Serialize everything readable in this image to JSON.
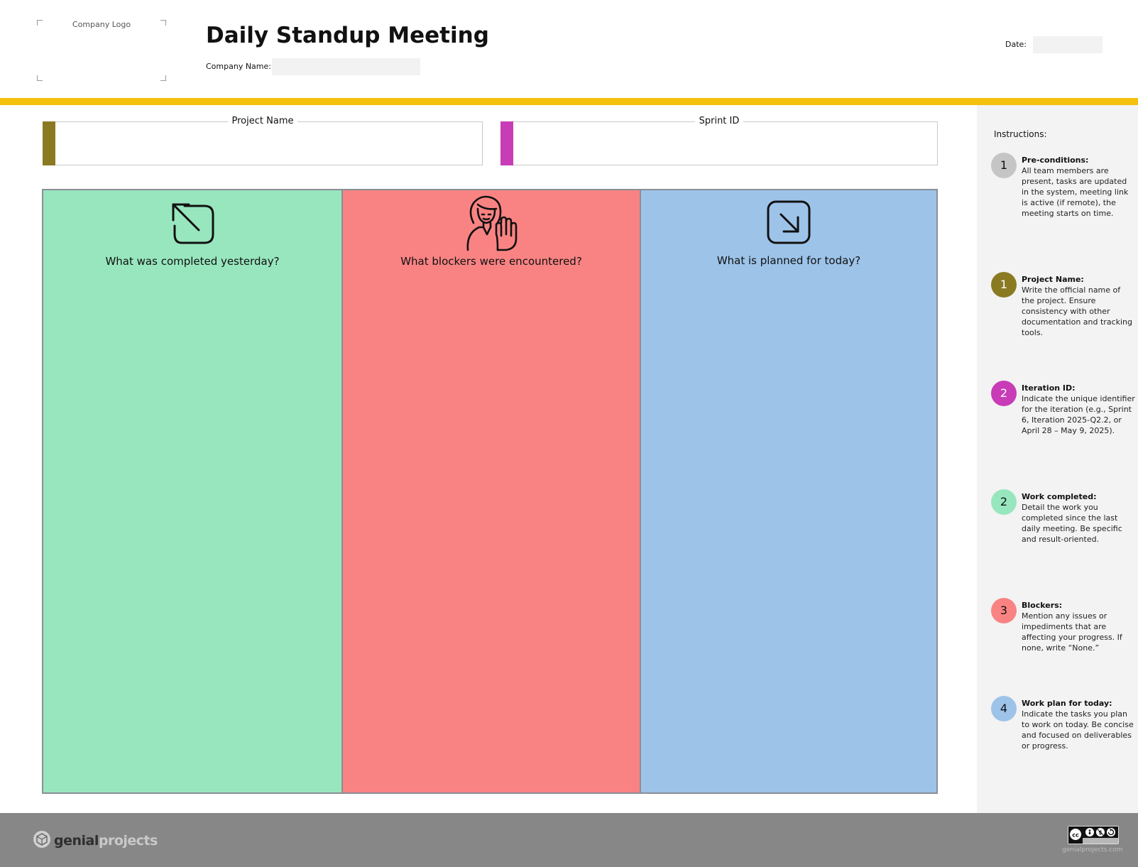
{
  "header": {
    "logo_placeholder": "Company Logo",
    "title": "Daily Standup Meeting",
    "company_label": "Company Name:",
    "date_label": "Date:"
  },
  "fields": {
    "project_name": "Project Name",
    "sprint_id": "Sprint ID"
  },
  "board": {
    "columns": [
      {
        "title": "What was completed yesterday?",
        "icon": "arrow-up-left-icon",
        "color": "#98e6be"
      },
      {
        "title": "What blockers were encountered?",
        "icon": "person-stop-hand-icon",
        "color": "#f98383"
      },
      {
        "title": "What is planned for today?",
        "icon": "arrow-down-right-icon",
        "color": "#9dc3e9"
      }
    ]
  },
  "instructions": {
    "title": "Instructions:",
    "steps": [
      {
        "number": "1",
        "color": "#c5c5c5",
        "heading": "Pre-conditions:",
        "text": "All team members are present, tasks are updated in the system, meeting link is active (if remote), the meeting starts on time."
      },
      {
        "number": "1",
        "color": "#8a7a22",
        "heading": "Project Name:",
        "text": "Write the official name of the project. Ensure consistency with other documentation and tracking tools."
      },
      {
        "number": "2",
        "color": "#c83cb7",
        "heading": "Iteration ID:",
        "text": "Indicate the unique identifier for the iteration (e.g., Sprint 6, Iteration 2025-Q2.2, or April 28 – May 9, 2025)."
      },
      {
        "number": "2",
        "color": "#98e6be",
        "heading": "Work completed:",
        "text": "Detail the work you completed since the last daily meeting. Be specific and result-oriented."
      },
      {
        "number": "3",
        "color": "#f98383",
        "heading": "Blockers:",
        "text": "Mention any issues or impediments that are affecting your progress. If none, write “None.”"
      },
      {
        "number": "4",
        "color": "#9dc3e9",
        "heading": "Work plan for today:",
        "text": "Indicate the tasks you plan to work on today. Be concise and focused on deliverables or progress."
      }
    ]
  },
  "footer": {
    "brand_part1": "genial",
    "brand_part2": "projects",
    "license_url": "genialprojects.com"
  },
  "colors": {
    "accent_yellow": "#f5c00c",
    "project_swatch": "#8a7a22",
    "sprint_swatch": "#c83cb7",
    "footer_gray": "#878787"
  }
}
